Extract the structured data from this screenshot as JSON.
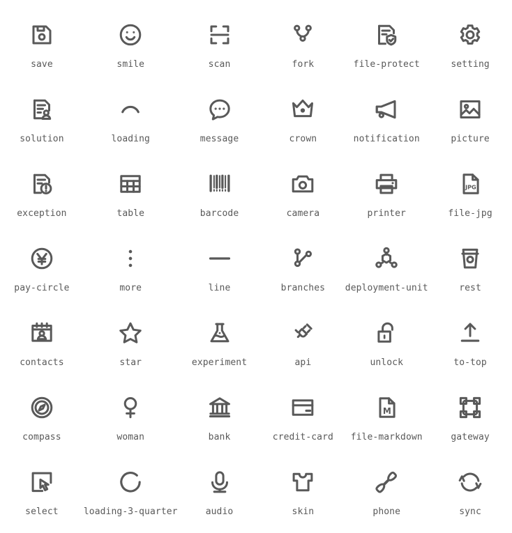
{
  "page": {
    "background_color": "#ffffff",
    "icon_color": "#595959",
    "label_color": "#595959",
    "columns": 6,
    "rows": 7
  },
  "icons": [
    {
      "name": "save",
      "label": "save",
      "glyph": "save-icon"
    },
    {
      "name": "smile",
      "label": "smile",
      "glyph": "smile-icon"
    },
    {
      "name": "scan",
      "label": "scan",
      "glyph": "scan-icon"
    },
    {
      "name": "fork",
      "label": "fork",
      "glyph": "fork-icon"
    },
    {
      "name": "file-protect",
      "label": "file-protect",
      "glyph": "file-protect-icon"
    },
    {
      "name": "setting",
      "label": "setting",
      "glyph": "setting-icon"
    },
    {
      "name": "solution",
      "label": "solution",
      "glyph": "solution-icon"
    },
    {
      "name": "loading",
      "label": "loading",
      "glyph": "loading-icon"
    },
    {
      "name": "message",
      "label": "message",
      "glyph": "message-icon"
    },
    {
      "name": "crown",
      "label": "crown",
      "glyph": "crown-icon"
    },
    {
      "name": "notification",
      "label": "notification",
      "glyph": "notification-icon"
    },
    {
      "name": "picture",
      "label": "picture",
      "glyph": "picture-icon"
    },
    {
      "name": "exception",
      "label": "exception",
      "glyph": "exception-icon"
    },
    {
      "name": "table",
      "label": "table",
      "glyph": "table-icon"
    },
    {
      "name": "barcode",
      "label": "barcode",
      "glyph": "barcode-icon"
    },
    {
      "name": "camera",
      "label": "camera",
      "glyph": "camera-icon"
    },
    {
      "name": "printer",
      "label": "printer",
      "glyph": "printer-icon"
    },
    {
      "name": "file-jpg",
      "label": "file-jpg",
      "glyph": "file-jpg-icon",
      "badge": "JPG"
    },
    {
      "name": "pay-circle",
      "label": "pay-circle",
      "glyph": "pay-circle-icon"
    },
    {
      "name": "more",
      "label": "more",
      "glyph": "more-icon"
    },
    {
      "name": "line",
      "label": "line",
      "glyph": "line-icon"
    },
    {
      "name": "branches",
      "label": "branches",
      "glyph": "branches-icon"
    },
    {
      "name": "deployment-unit",
      "label": "deployment-unit",
      "glyph": "deployment-unit-icon"
    },
    {
      "name": "rest",
      "label": "rest",
      "glyph": "rest-icon"
    },
    {
      "name": "contacts",
      "label": "contacts",
      "glyph": "contacts-icon"
    },
    {
      "name": "star",
      "label": "star",
      "glyph": "star-icon"
    },
    {
      "name": "experiment",
      "label": "experiment",
      "glyph": "experiment-icon"
    },
    {
      "name": "api",
      "label": "api",
      "glyph": "api-icon"
    },
    {
      "name": "unlock",
      "label": "unlock",
      "glyph": "unlock-icon"
    },
    {
      "name": "to-top",
      "label": "to-top",
      "glyph": "to-top-icon"
    },
    {
      "name": "compass",
      "label": "compass",
      "glyph": "compass-icon"
    },
    {
      "name": "woman",
      "label": "woman",
      "glyph": "woman-icon"
    },
    {
      "name": "bank",
      "label": "bank",
      "glyph": "bank-icon"
    },
    {
      "name": "credit-card",
      "label": "credit-card",
      "glyph": "credit-card-icon"
    },
    {
      "name": "file-markdown",
      "label": "file-markdown",
      "glyph": "file-markdown-icon",
      "badge": "M"
    },
    {
      "name": "gateway",
      "label": "gateway",
      "glyph": "gateway-icon"
    },
    {
      "name": "select",
      "label": "select",
      "glyph": "select-icon"
    },
    {
      "name": "loading-3-quarter",
      "label": "loading-3-quarter",
      "glyph": "loading-3-quarter-icon"
    },
    {
      "name": "audio",
      "label": "audio",
      "glyph": "audio-icon"
    },
    {
      "name": "skin",
      "label": "skin",
      "glyph": "skin-icon"
    },
    {
      "name": "phone",
      "label": "phone",
      "glyph": "phone-icon"
    },
    {
      "name": "sync",
      "label": "sync",
      "glyph": "sync-icon"
    }
  ]
}
